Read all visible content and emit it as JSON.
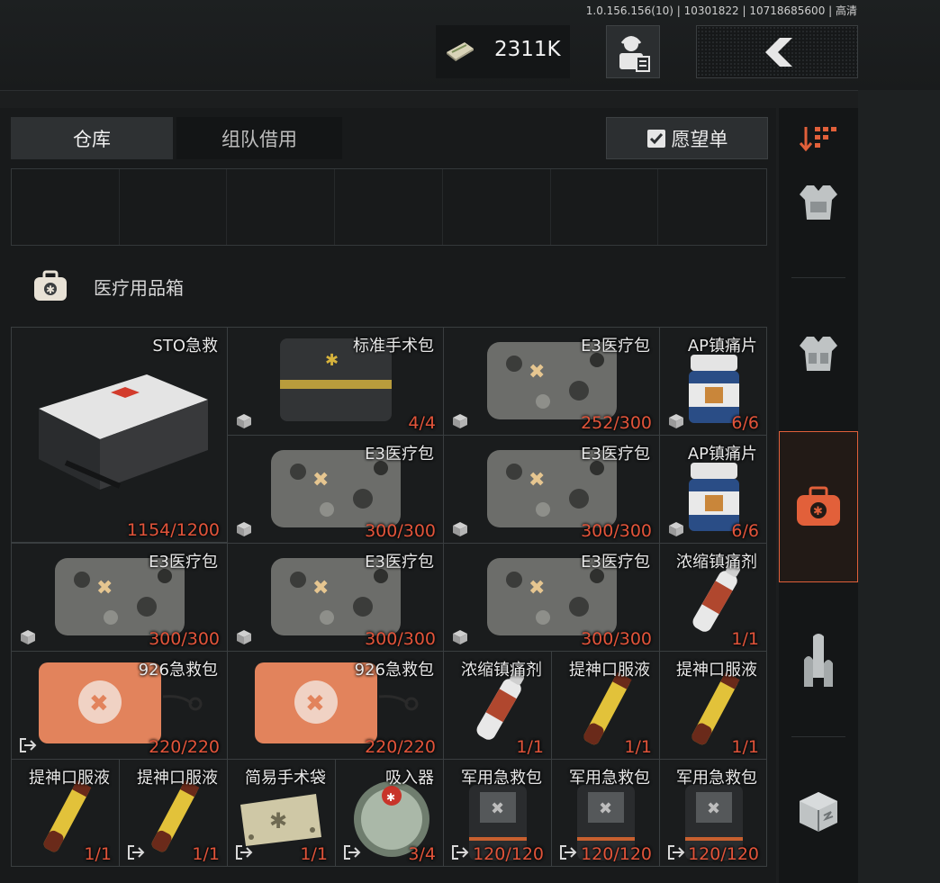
{
  "header": {
    "version": "1.0.156.156(10) | 10301822 | 10718685600 | 高清",
    "cash": "2311K",
    "cash_icon": "cash-bundle-icon",
    "profile_icon": "operator-profile-icon",
    "back_icon": "back-chevron-icon"
  },
  "tabs": [
    {
      "label": "仓库"
    },
    {
      "label": "组队借用"
    }
  ],
  "wishlist": {
    "label": "愿望单"
  },
  "section": {
    "title": "医疗用品箱"
  },
  "items": [
    {
      "name": "STO急救",
      "qty": "1154/1200"
    },
    {
      "name": "标准手术包",
      "qty": "4/4"
    },
    {
      "name": "E3医疗包",
      "qty": "252/300"
    },
    {
      "name": "AP镇痛片",
      "qty": "6/6"
    },
    {
      "name": "E3医疗包",
      "qty": "300/300"
    },
    {
      "name": "E3医疗包",
      "qty": "300/300"
    },
    {
      "name": "AP镇痛片",
      "qty": "6/6"
    },
    {
      "name": "E3医疗包",
      "qty": "300/300"
    },
    {
      "name": "E3医疗包",
      "qty": "300/300"
    },
    {
      "name": "E3医疗包",
      "qty": "300/300"
    },
    {
      "name": "浓缩镇痛剂",
      "qty": "1/1"
    },
    {
      "name": "926急救包",
      "qty": "220/220"
    },
    {
      "name": "926急救包",
      "qty": "220/220"
    },
    {
      "name": "浓缩镇痛剂",
      "qty": "1/1"
    },
    {
      "name": "提神口服液",
      "qty": "1/1"
    },
    {
      "name": "提神口服液",
      "qty": "1/1"
    },
    {
      "name": "提神口服液",
      "qty": "1/1"
    },
    {
      "name": "提神口服液",
      "qty": "1/1"
    },
    {
      "name": "简易手术袋",
      "qty": "1/1"
    },
    {
      "name": "吸入器",
      "qty": "3/4"
    },
    {
      "name": "军用急救包",
      "qty": "120/120"
    },
    {
      "name": "军用急救包",
      "qty": "120/120"
    },
    {
      "name": "军用急救包",
      "qty": "120/120"
    }
  ],
  "sidebar": [
    {
      "icon": "sort-filter-icon"
    },
    {
      "icon": "body-armor-icon"
    },
    {
      "icon": "chest-rig-icon"
    },
    {
      "icon": "medical-kit-icon",
      "active": true
    },
    {
      "icon": "ammo-icon"
    },
    {
      "icon": "supply-crate-icon"
    }
  ],
  "colors": {
    "accent": "#e2543a",
    "active_border": "#e0603a"
  }
}
